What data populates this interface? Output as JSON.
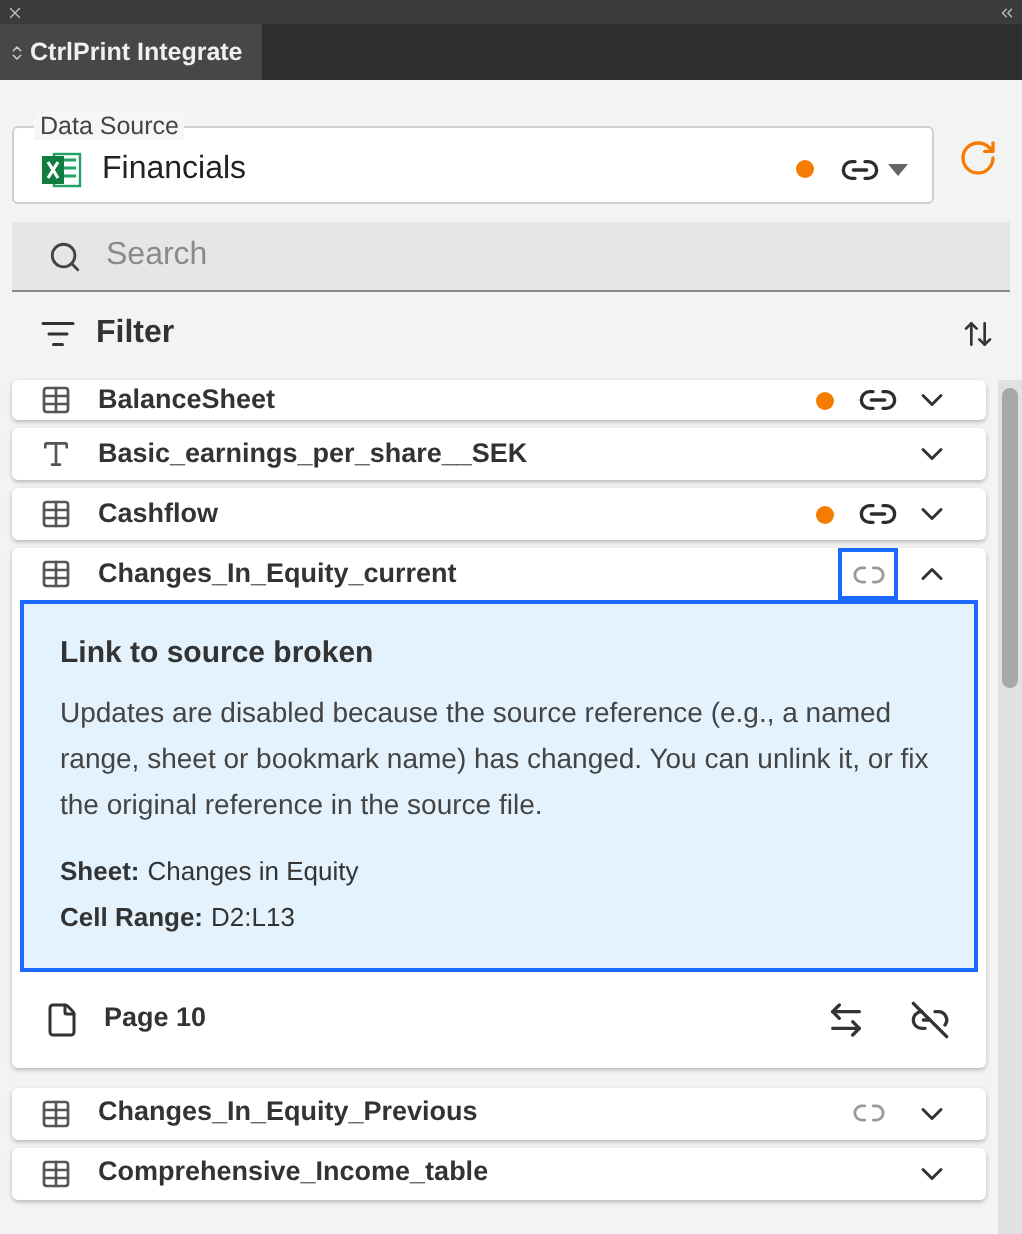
{
  "panel": {
    "title": "CtrlPrint Integrate"
  },
  "data_source": {
    "label": "Data Source",
    "value": "Financials",
    "status_dot": true
  },
  "search": {
    "placeholder": "Search"
  },
  "filter": {
    "label": "Filter"
  },
  "items": [
    {
      "kind": "table",
      "name": "BalanceSheet",
      "status_dot": true,
      "linked": true,
      "link_broken": false,
      "expanded": false
    },
    {
      "kind": "text",
      "name": "Basic_earnings_per_share__SEK",
      "status_dot": false,
      "linked": false,
      "link_broken": false,
      "expanded": false
    },
    {
      "kind": "table",
      "name": "Cashflow",
      "status_dot": true,
      "linked": true,
      "link_broken": false,
      "expanded": false
    },
    {
      "kind": "table",
      "name": "Changes_In_Equity_current",
      "status_dot": false,
      "linked": false,
      "link_broken": true,
      "link_selected": true,
      "expanded": true,
      "notice": {
        "title": "Link to source broken",
        "message": "Updates are disabled because the source reference (e.g., a named range, sheet or bookmark name) has changed. You can unlink it, or fix the original reference in the source file.",
        "details": [
          {
            "label": "Sheet:",
            "value": "Changes in Equity"
          },
          {
            "label": "Cell Range:",
            "value": "D2:L13"
          }
        ]
      },
      "page": "Page 10"
    },
    {
      "kind": "table",
      "name": "Changes_In_Equity_Previous",
      "status_dot": false,
      "linked": false,
      "link_broken": true,
      "link_selected": false,
      "expanded": false
    },
    {
      "kind": "table",
      "name": "Comprehensive_Income_table",
      "status_dot": false,
      "linked": false,
      "link_broken": false,
      "expanded": false
    }
  ]
}
